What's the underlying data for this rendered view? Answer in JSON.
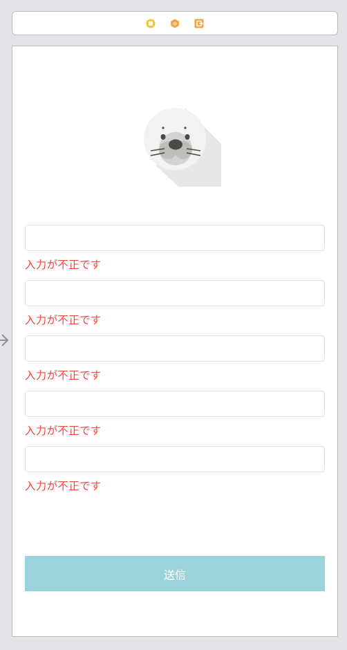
{
  "scene_dock": {
    "icons": [
      "view-controller-icon",
      "first-responder-icon",
      "exit-icon"
    ],
    "colors": {
      "view_controller": "#f5c433",
      "first_responder": "#f0a141",
      "exit": "#f0a141"
    }
  },
  "segue": {
    "icon": "entry-arrow-icon"
  },
  "form": {
    "fields": [
      {
        "value": "",
        "placeholder": "",
        "error": "入力が不正です"
      },
      {
        "value": "",
        "placeholder": "",
        "error": "入力が不正です"
      },
      {
        "value": "",
        "placeholder": "",
        "error": "入力が不正です"
      },
      {
        "value": "",
        "placeholder": "",
        "error": "入力が不正です"
      },
      {
        "value": "",
        "placeholder": "",
        "error": "入力が不正です"
      }
    ],
    "submit_label": "送信"
  },
  "colors": {
    "error_text": "#f04a3f",
    "button_bg": "#9ad3dc",
    "button_text": "#ffffff",
    "field_border": "#e0e0e0"
  },
  "logo": {
    "icon": "seal-icon"
  }
}
